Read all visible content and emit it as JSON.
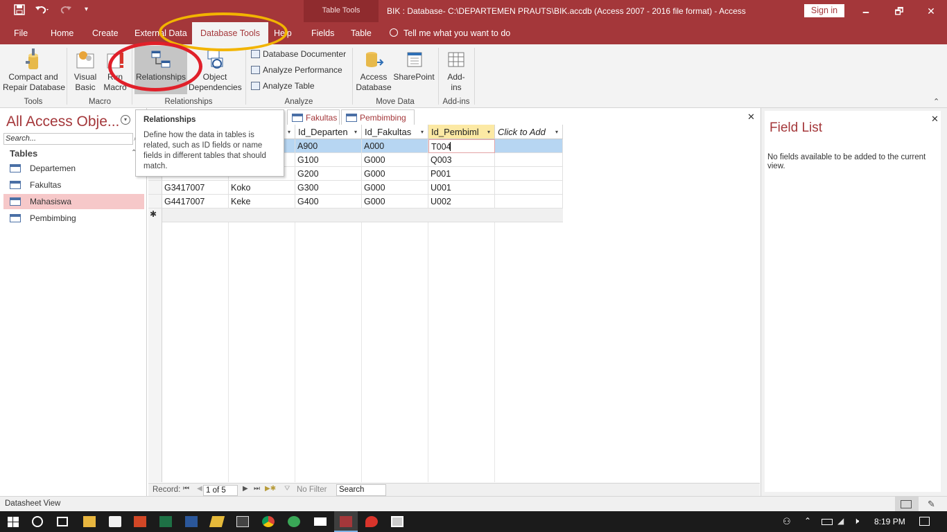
{
  "window": {
    "title": "BIK : Database- C:\\DEPARTEMEN PRAUTS\\BIK.accdb (Access 2007 - 2016 file format)  -  Access",
    "context_tools_label": "Table Tools",
    "sign_in": "Sign in",
    "minimize": "🗕",
    "restore": "🗗",
    "close": "✕"
  },
  "tabs": [
    "File",
    "Home",
    "Create",
    "External Data",
    "Database Tools",
    "Help",
    "Fields",
    "Table"
  ],
  "active_tab": "Database Tools",
  "tell_me": "Tell me what you want to do",
  "ribbon": {
    "compact": "Compact and\nRepair Database",
    "visual_basic": "Visual\nBasic",
    "run_macro": "Run\nMacro",
    "relationships": "Relationships",
    "object_dependencies": "Object\nDependencies",
    "db_documenter": "Database Documenter",
    "analyze_performance": "Analyze Performance",
    "analyze_table": "Analyze Table",
    "access_database": "Access\nDatabase",
    "sharepoint": "SharePoint",
    "add_ins": "Add-\nins",
    "groups": {
      "tools": "Tools",
      "macro": "Macro",
      "relationships": "Relationships",
      "analyze": "Analyze",
      "move_data": "Move Data",
      "add_ins": "Add-ins"
    }
  },
  "nav": {
    "title": "All Access Obje...",
    "search_placeholder": "Search...",
    "section": "Tables",
    "items": [
      "Departemen",
      "Fakultas",
      "Mahasiswa",
      "Pembimbing"
    ],
    "selected": "Mahasiswa"
  },
  "doc_tabs": [
    "Fakultas",
    "Pembimbing"
  ],
  "tooltip": {
    "title": "Relationships",
    "body": "Define how the data in tables is related, such as ID fields or name fields in different tables that should match."
  },
  "table": {
    "columns": [
      "Id_Departen",
      "Id_Fakultas",
      "Id_Pembiml",
      "Click to Add"
    ],
    "rows": [
      {
        "id": "",
        "name": "",
        "dep": "A900",
        "fak": "A000",
        "pem": "T004"
      },
      {
        "id": "",
        "name": "",
        "dep": "G100",
        "fak": "G000",
        "pem": "Q003"
      },
      {
        "id": "",
        "name": "",
        "dep": "G200",
        "fak": "G000",
        "pem": "P001"
      },
      {
        "id": "G3417007",
        "name": "Koko",
        "dep": "G300",
        "fak": "G000",
        "pem": "U001"
      },
      {
        "id": "G4417007",
        "name": "Keke",
        "dep": "G400",
        "fak": "G000",
        "pem": "U002"
      }
    ],
    "new_row_marker": "✱"
  },
  "record_nav": {
    "label": "Record:",
    "position": "1 of 5",
    "filter": "No Filter",
    "search": "Search"
  },
  "field_list": {
    "title": "Field List",
    "message": "No fields available to be added to the current view."
  },
  "status": {
    "view": "Datasheet View"
  },
  "taskbar": {
    "time": "8:19 PM"
  },
  "colors": {
    "accent": "#a4373a",
    "selection_row": "#b7d6f2",
    "highlight_ring_red": "#e0202a",
    "highlight_ring_yellow": "#f2b400"
  }
}
